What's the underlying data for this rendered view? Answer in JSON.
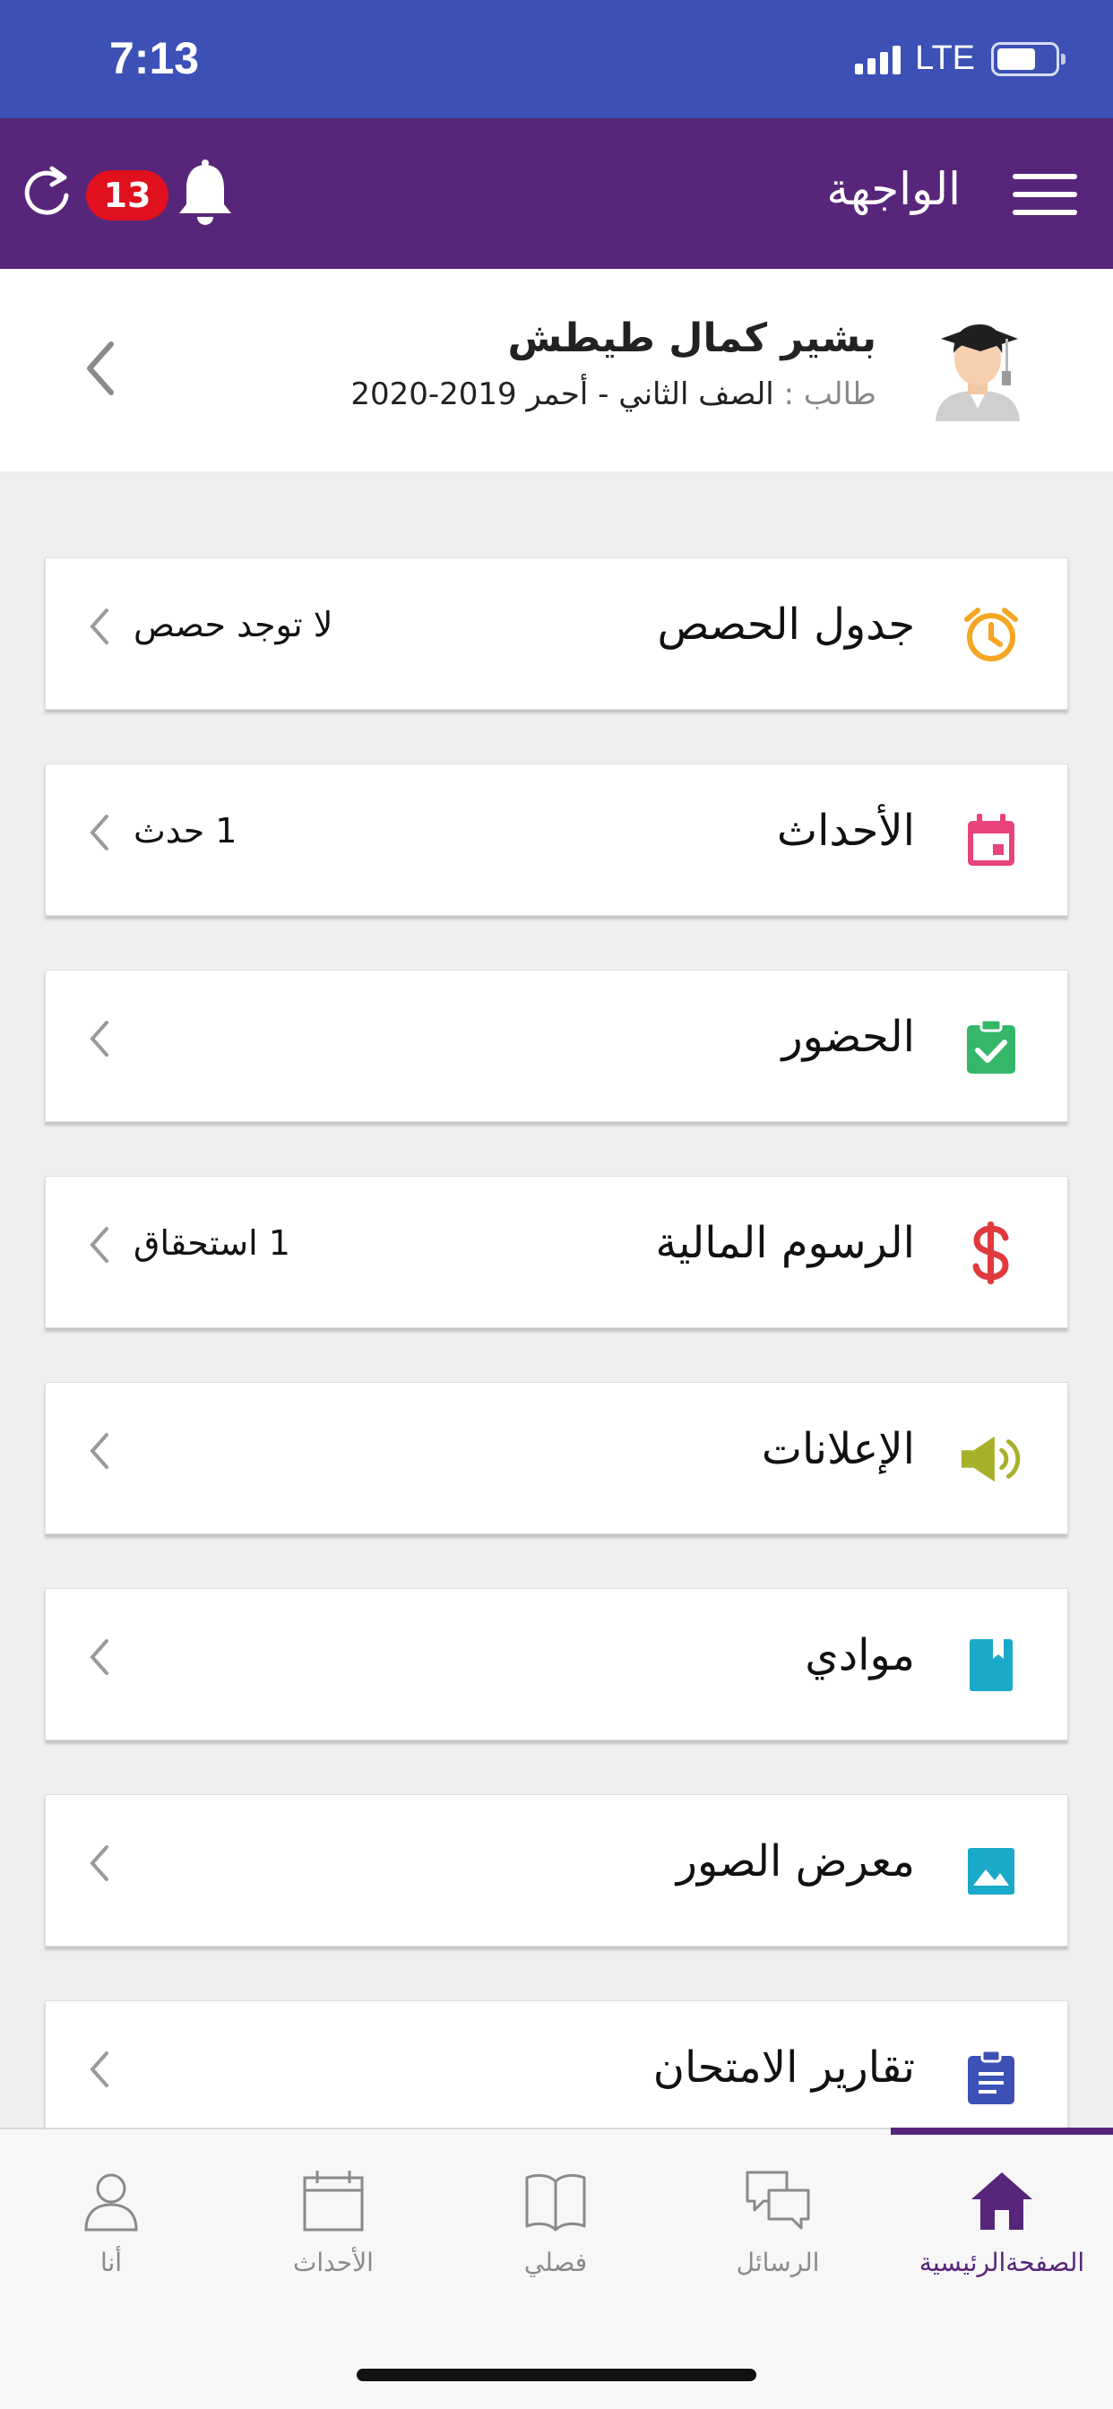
{
  "status_bar": {
    "time": "7:13",
    "network": "LTE"
  },
  "header": {
    "title": "الواجهة",
    "notification_count": "13"
  },
  "profile": {
    "name": "بشير كمال طيطش",
    "role": "طالب",
    "separator": " : ",
    "details": "الصف الثاني - أحمر 2019-2020"
  },
  "menu": [
    {
      "label": "جدول الحصص",
      "value": "لا توجد حصص",
      "icon": "alarm-clock-icon",
      "color": "#f5a623"
    },
    {
      "label": "الأحداث",
      "value": "1 حدث",
      "icon": "calendar-icon",
      "color": "#e8437a"
    },
    {
      "label": "الحضور",
      "value": "",
      "icon": "attendance-check-icon",
      "color": "#34b768"
    },
    {
      "label": "الرسوم المالية",
      "value": "1 استحقاق",
      "icon": "dollar-icon",
      "color": "#e0393e"
    },
    {
      "label": "الإعلانات",
      "value": "",
      "icon": "megaphone-icon",
      "color": "#a8b02a"
    },
    {
      "label": "موادي",
      "value": "",
      "icon": "book-icon",
      "color": "#1aa9c8"
    },
    {
      "label": "معرض الصور",
      "value": "",
      "icon": "image-icon",
      "color": "#1aa9c8"
    },
    {
      "label": "تقارير الامتحان",
      "value": "",
      "icon": "clipboard-icon",
      "color": "#3c50b6"
    }
  ],
  "tabs": [
    {
      "label": "أنا",
      "icon": "person-icon"
    },
    {
      "label": "الأحداث",
      "icon": "calendar-outline-icon"
    },
    {
      "label": "فصلي",
      "icon": "open-book-icon"
    },
    {
      "label": "الرسائل",
      "icon": "chat-bubbles-icon"
    },
    {
      "label": "الصفحةالرئيسية",
      "icon": "home-icon",
      "active": true
    }
  ],
  "colors": {
    "status_bar": "#3c50b6",
    "header": "#57267a",
    "badge": "#e0101e"
  }
}
